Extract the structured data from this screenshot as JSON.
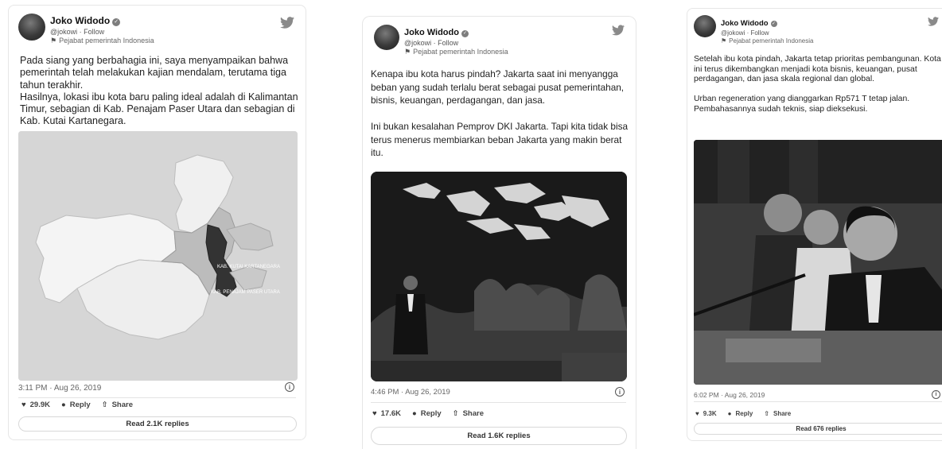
{
  "colors": {
    "text": "#1a1a1a",
    "muted": "#666666",
    "border": "#e6e6e6"
  },
  "tweets": [
    {
      "author": "Joko Widodo",
      "handle_follow": "@jokowi · Follow",
      "role": "Pejabat pemerintah Indonesia",
      "text": "Pada siang yang berbahagia ini, saya menyampaikan bahwa pemerintah telah melakukan kajian mendalam, terutama tiga tahun terakhir.\nHasilnya, lokasi ibu kota baru paling ideal adalah di Kalimantan Timur, sebagian di Kab. Penajam Paser Utara dan sebagian di Kab. Kutai Kartanegara.",
      "media": {
        "kind": "map",
        "labels": [
          "KAB. KUTAI KARTANEGARA",
          "KAB. PENAJAM PASER UTARA"
        ]
      },
      "time": "3:11 PM · Aug 26, 2019",
      "likes": "29.9K",
      "reply_label": "Reply",
      "share_label": "Share",
      "read_replies": "Read 2.1K replies",
      "icons": {
        "bird": "twitter-bird-icon",
        "like": "heart-icon",
        "reply": "comment-icon",
        "share": "share-icon",
        "info": "info-icon",
        "flag": "flag-icon"
      }
    },
    {
      "author": "Joko Widodo",
      "handle_follow": "@jokowi · Follow",
      "role": "Pejabat pemerintah Indonesia",
      "text": "Kenapa ibu kota harus pindah? Jakarta saat ini menyangga beban yang sudah terlalu berat sebagai pusat pemerintahan, bisnis, keuangan, perdagangan, dan jasa.\n\nIni bukan kesalahan Pemprov DKI Jakarta. Tapi kita tidak bisa terus menerus membiarkan beban Jakarta yang makin berat itu.",
      "media": {
        "kind": "photo"
      },
      "time": "4:46 PM · Aug 26, 2019",
      "likes": "17.6K",
      "reply_label": "Reply",
      "share_label": "Share",
      "read_replies": "Read 1.6K replies"
    },
    {
      "author": "Joko Widodo",
      "handle_follow": "@jokowi · Follow",
      "role": "Pejabat pemerintah Indonesia",
      "text": "Setelah ibu kota pindah, Jakarta tetap prioritas pembangunan. Kota ini terus dikembangkan menjadi kota bisnis, keuangan, pusat perdagangan, dan jasa skala regional dan global.\n\nUrban regeneration yang dianggarkan Rp571 T tetap jalan. Pembahasannya sudah teknis, siap dieksekusi.",
      "media": {
        "kind": "photo"
      },
      "time": "6:02 PM · Aug 26, 2019",
      "likes": "9.3K",
      "reply_label": "Reply",
      "share_label": "Share",
      "read_replies": "Read 676 replies"
    }
  ]
}
